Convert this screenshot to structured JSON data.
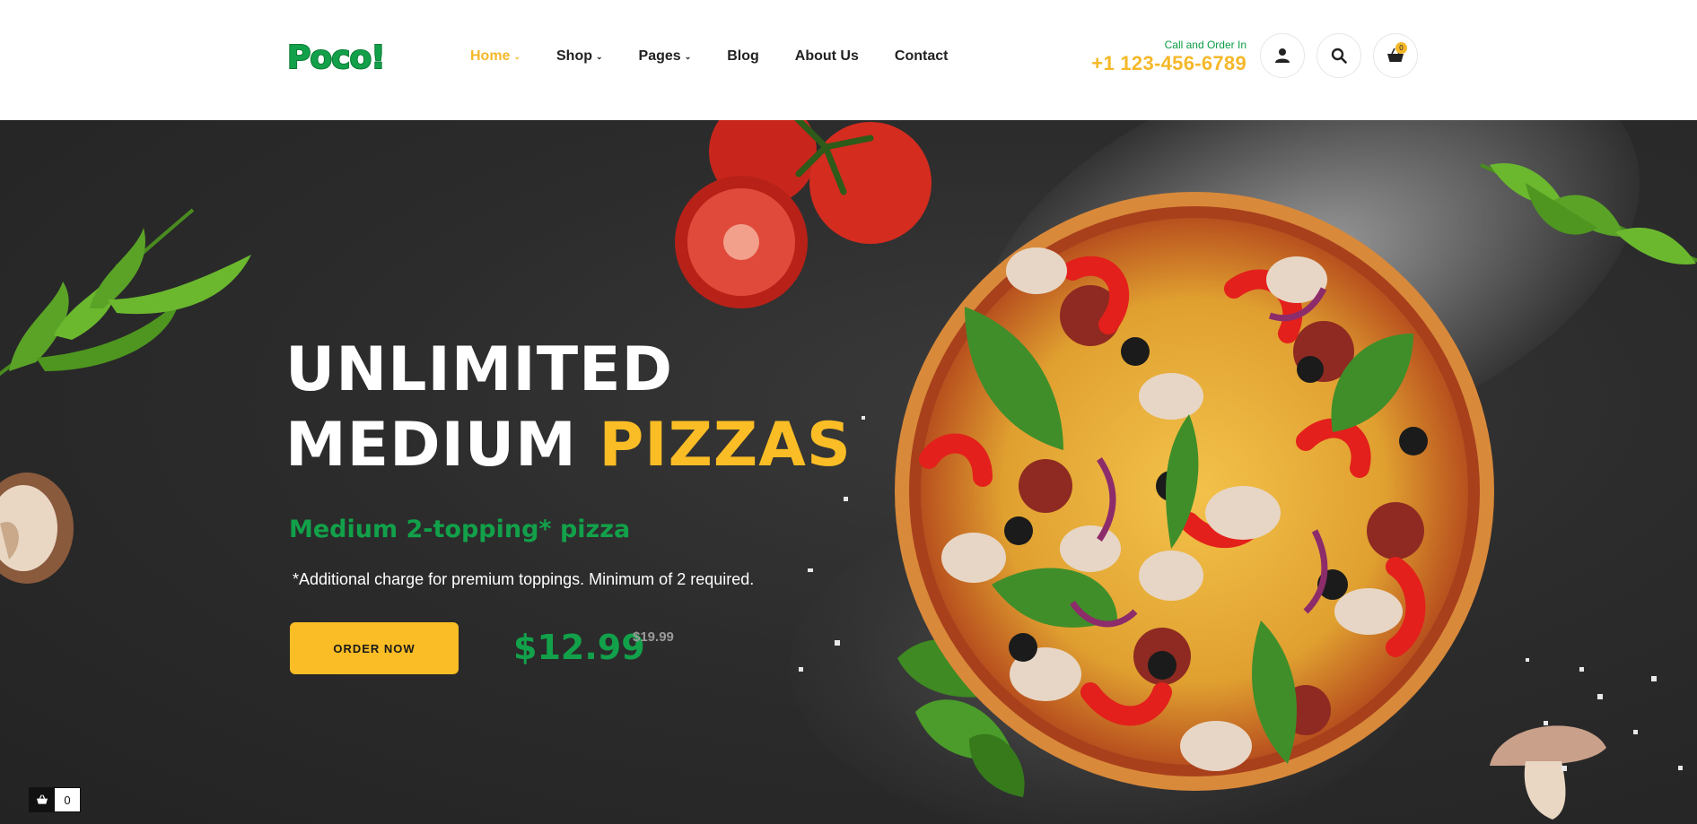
{
  "brand": {
    "logo_text": "Poco!"
  },
  "nav": {
    "items": [
      {
        "label": "Home",
        "active": true,
        "has_dropdown": true
      },
      {
        "label": "Shop",
        "active": false,
        "has_dropdown": true
      },
      {
        "label": "Pages",
        "active": false,
        "has_dropdown": true
      },
      {
        "label": "Blog",
        "active": false,
        "has_dropdown": false
      },
      {
        "label": "About Us",
        "active": false,
        "has_dropdown": false
      },
      {
        "label": "Contact",
        "active": false,
        "has_dropdown": false
      }
    ]
  },
  "contact": {
    "label": "Call and Order In",
    "phone": "+1 123-456-6789"
  },
  "header_actions": {
    "account_icon": "user-icon",
    "search_icon": "search-icon",
    "cart_icon": "basket-icon",
    "cart_count": "0"
  },
  "hero": {
    "title_line1": "UNLIMITED",
    "title_line2_white": "MEDIUM",
    "title_line2_accent": "PIZZAS",
    "subtitle": "Medium 2-topping* pizza",
    "note": "*Additional charge for premium toppings. Minimum of 2 required.",
    "cta_label": "ORDER NOW",
    "price": "$12.99",
    "old_price": "$19.99"
  },
  "mini_cart": {
    "count": "0",
    "icon": "basket-icon"
  },
  "colors": {
    "accent_yellow": "#fbbd25",
    "brand_green": "#12a14a",
    "hero_bg": "#2b2b2b"
  }
}
